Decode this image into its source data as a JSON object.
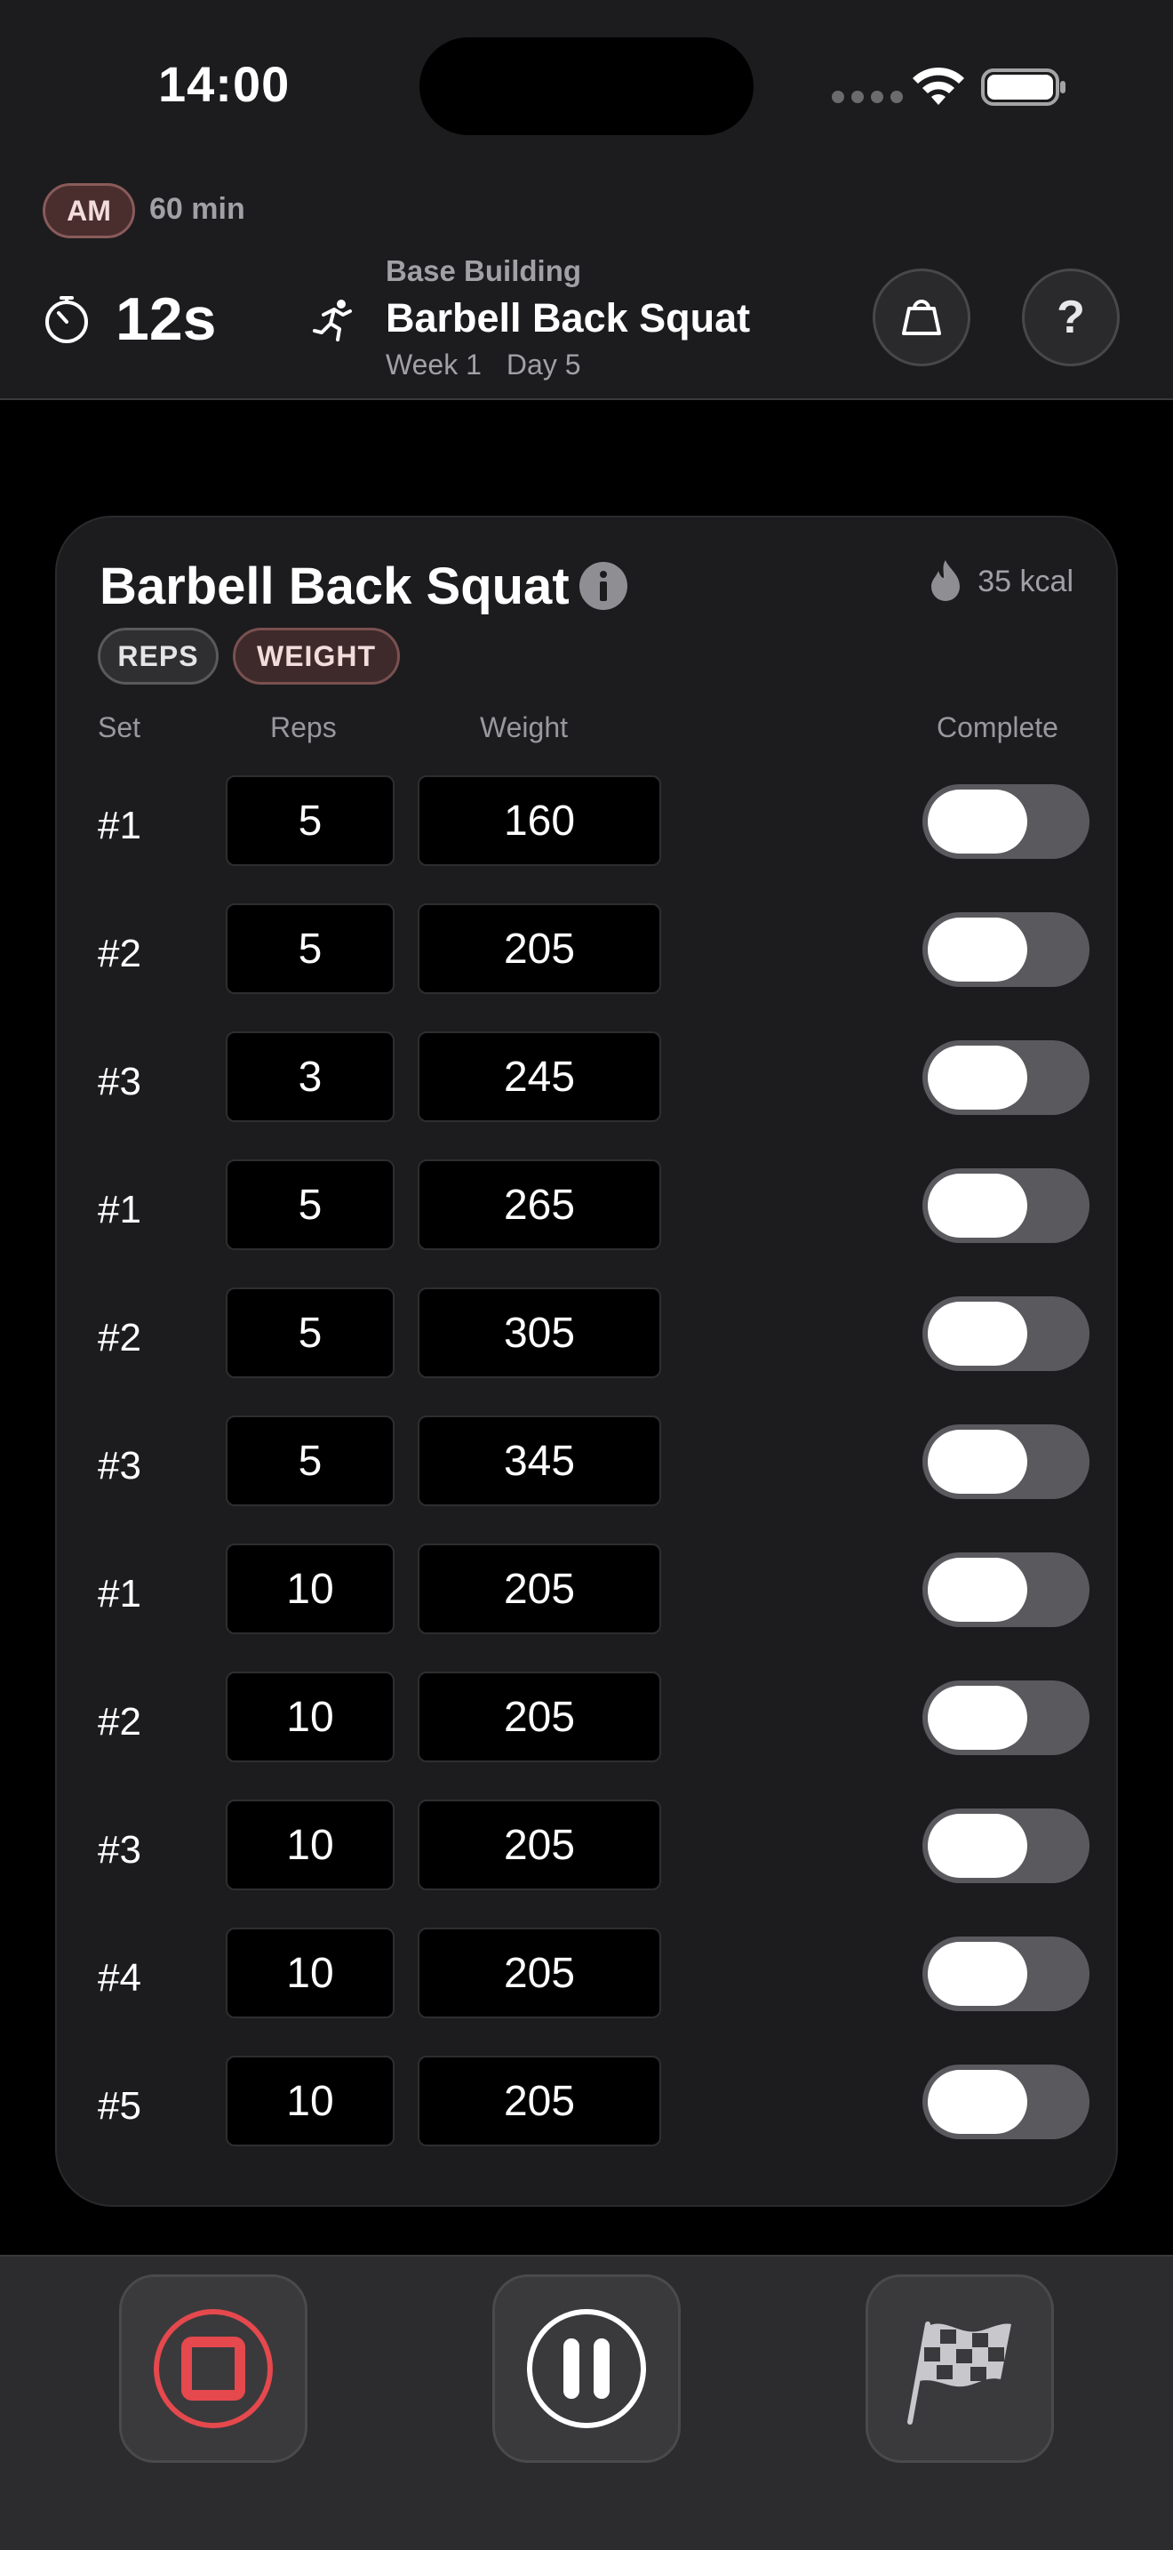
{
  "status_bar": {
    "time": "14:00"
  },
  "header": {
    "session_badge": "AM",
    "duration": "60 min",
    "timer": "12s",
    "program": "Base Building",
    "exercise": "Barbell Back Squat",
    "week": "Week 1",
    "day": "Day 5",
    "help_label": "?"
  },
  "card": {
    "title": "Barbell Back Squat",
    "kcal": "35 kcal",
    "chips": {
      "reps": "REPS",
      "weight": "WEIGHT"
    },
    "columns": {
      "set": "Set",
      "reps": "Reps",
      "weight": "Weight",
      "complete": "Complete"
    },
    "sets": [
      {
        "label": "#1",
        "reps": "5",
        "weight": "160"
      },
      {
        "label": "#2",
        "reps": "5",
        "weight": "205"
      },
      {
        "label": "#3",
        "reps": "3",
        "weight": "245"
      },
      {
        "label": "#1",
        "reps": "5",
        "weight": "265"
      },
      {
        "label": "#2",
        "reps": "5",
        "weight": "305"
      },
      {
        "label": "#3",
        "reps": "5",
        "weight": "345"
      },
      {
        "label": "#1",
        "reps": "10",
        "weight": "205"
      },
      {
        "label": "#2",
        "reps": "10",
        "weight": "205"
      },
      {
        "label": "#3",
        "reps": "10",
        "weight": "205"
      },
      {
        "label": "#4",
        "reps": "10",
        "weight": "205"
      },
      {
        "label": "#5",
        "reps": "10",
        "weight": "205"
      }
    ]
  },
  "controls": {
    "stop": "stop-icon",
    "pause": "pause-icon",
    "finish": "checkered-flag-icon"
  },
  "colors": {
    "stop_red": "#e5484d",
    "am_badge_bg": "#4a2e2e",
    "toggle_off": "#5a5a5e"
  }
}
